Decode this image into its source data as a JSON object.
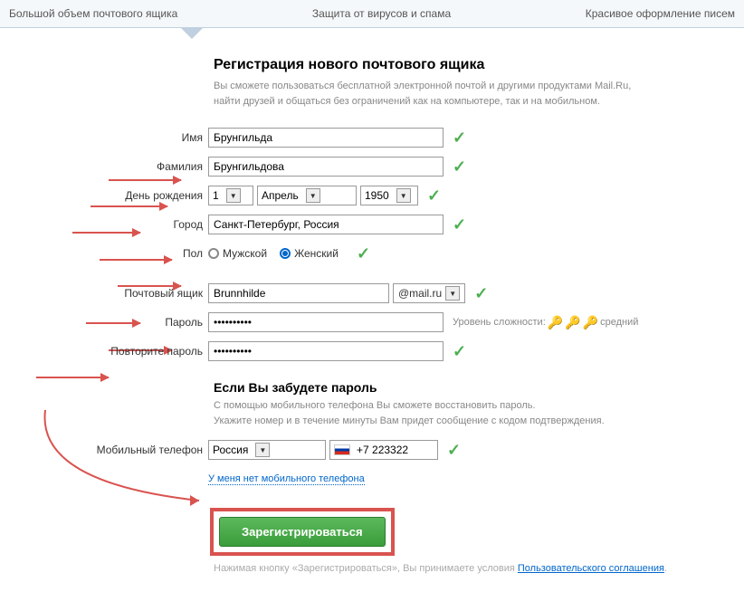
{
  "top": {
    "item1": "Большой объем почтового ящика",
    "item2": "Защита от вирусов и спама",
    "item3": "Красивое оформление писем"
  },
  "header": {
    "title": "Регистрация нового почтового ящика",
    "sub1": "Вы сможете пользоваться бесплатной электронной почтой и другими продуктами Mail.Ru,",
    "sub2": "найти друзей и общаться без ограничений как на компьютере, так и на мобильном."
  },
  "labels": {
    "name": "Имя",
    "surname": "Фамилия",
    "birthday": "День рождения",
    "city": "Город",
    "gender": "Пол",
    "mailbox": "Почтовый ящик",
    "password": "Пароль",
    "password2": "Повторите пароль",
    "phone": "Мобильный телефон"
  },
  "values": {
    "name": "Брунгильда",
    "surname": "Брунгильдова",
    "day": "1",
    "month": "Апрель",
    "year": "1950",
    "city": "Санкт-Петербург, Россия",
    "male": "Мужской",
    "female": "Женский",
    "mailbox": "Brunnhilde",
    "domain": "@mail.ru",
    "password": "••••••••••",
    "password2": "••••••••••",
    "country": "Россия",
    "phone": "+7 223322"
  },
  "forgot": {
    "title": "Если Вы забудете пароль",
    "sub1": "С помощью мобильного телефона Вы сможете восстановить пароль.",
    "sub2": "Укажите номер и в течение минуты Вам придет сообщение с кодом подтверждения."
  },
  "links": {
    "nophone": "У меня нет мобильного телефона",
    "agreement": "Пользовательского соглашения"
  },
  "button": "Зарегистрироваться",
  "agreement_pre": "Нажимая кнопку «Зарегистрироваться», Вы принимаете условия ",
  "strength": {
    "label": "Уровень сложности:",
    "level": "средний"
  }
}
